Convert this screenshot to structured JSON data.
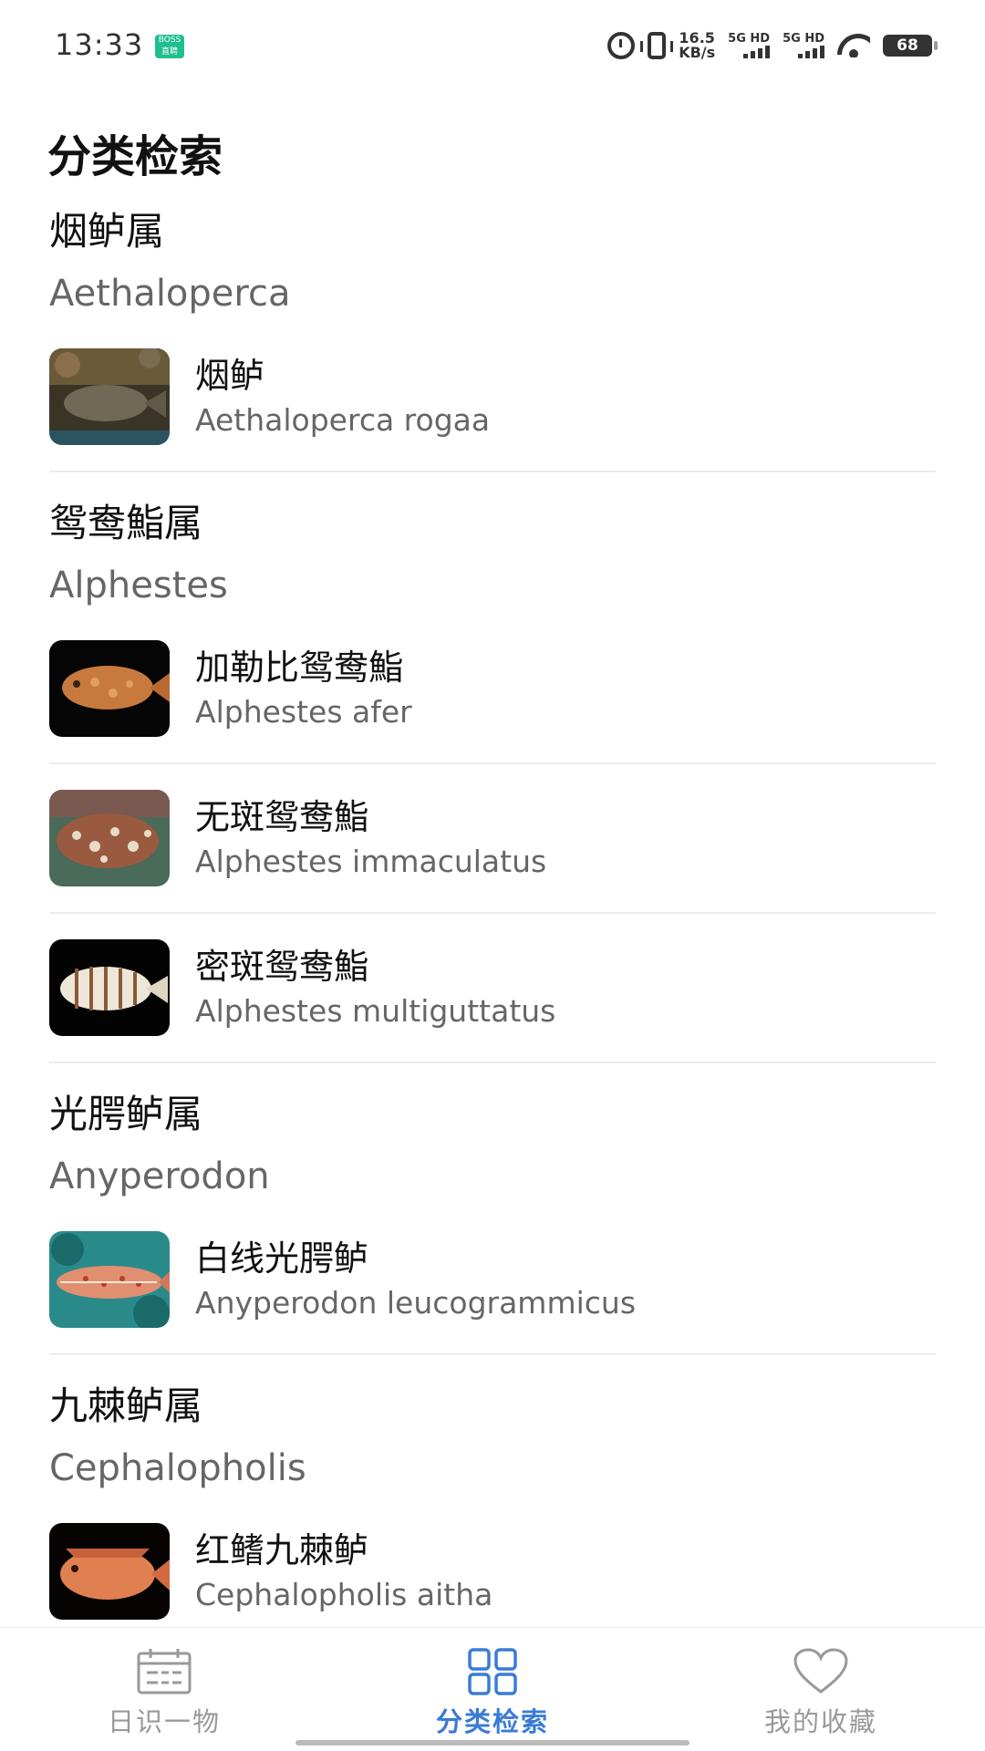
{
  "status_bar": {
    "time": "13:33",
    "app_badge": "BOSS 直聘",
    "net_speed_value": "16.5",
    "net_speed_unit": "KB/s",
    "sim1_label": "5G HD",
    "sim2_label": "5G HD",
    "battery": "68"
  },
  "page": {
    "title": "分类检索"
  },
  "genera": [
    {
      "name_cn": "烟鲈属",
      "name_latin": "Aethaloperca",
      "species": [
        {
          "name_cn": "烟鲈",
          "name_latin": "Aethaloperca rogaa"
        }
      ]
    },
    {
      "name_cn": "鸳鸯鮨属",
      "name_latin": "Alphestes",
      "species": [
        {
          "name_cn": "加勒比鸳鸯鮨",
          "name_latin": "Alphestes afer"
        },
        {
          "name_cn": "无斑鸳鸯鮨",
          "name_latin": "Alphestes immaculatus"
        },
        {
          "name_cn": "密斑鸳鸯鮨",
          "name_latin": "Alphestes multiguttatus"
        }
      ]
    },
    {
      "name_cn": "光腭鲈属",
      "name_latin": "Anyperodon",
      "species": [
        {
          "name_cn": "白线光腭鲈",
          "name_latin": "Anyperodon leucogrammicus"
        }
      ]
    },
    {
      "name_cn": "九棘鲈属",
      "name_latin": "Cephalopholis",
      "species": [
        {
          "name_cn": "红鳍九棘鲈",
          "name_latin": "Cephalopholis aitha"
        }
      ]
    }
  ],
  "bottom_nav": {
    "items": [
      {
        "label": "日识一物",
        "icon": "calendar-icon"
      },
      {
        "label": "分类检索",
        "icon": "grid-icon"
      },
      {
        "label": "我的收藏",
        "icon": "heart-icon"
      }
    ],
    "active_index": 1,
    "active_color": "#3a7bd5",
    "inactive_color": "#999999"
  }
}
